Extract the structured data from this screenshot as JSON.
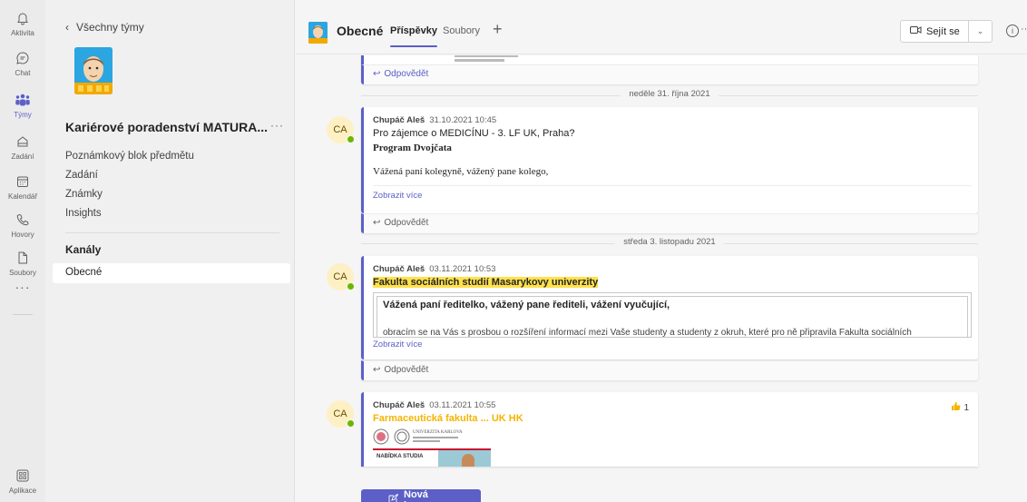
{
  "rail": {
    "items": [
      {
        "label": "Aktivita",
        "icon": "bell-icon"
      },
      {
        "label": "Chat",
        "icon": "chat-icon"
      },
      {
        "label": "Týmy",
        "icon": "teams-icon"
      },
      {
        "label": "Zadání",
        "icon": "assignments-icon"
      },
      {
        "label": "Kalendář",
        "icon": "calendar-icon"
      },
      {
        "label": "Hovory",
        "icon": "phone-icon"
      },
      {
        "label": "Soubory",
        "icon": "file-icon"
      }
    ],
    "more": "···",
    "apps_label": "Aplikace"
  },
  "teampanel": {
    "back_label": "Všechny týmy",
    "team_name": "Kariérové poradenství MATURA...",
    "more": "···",
    "nav": [
      "Poznámkový blok předmětu",
      "Zadání",
      "Známky",
      "Insights"
    ],
    "channels_heading": "Kanály",
    "channel_active": "Obecné"
  },
  "header": {
    "channel_name": "Obecné",
    "tabs": [
      "Příspěvky",
      "Soubory"
    ],
    "add_tab": "+",
    "meet_label": "Sejít se",
    "more": "··"
  },
  "feed": {
    "reply_label": "Odpovědět",
    "top_reply": "Odpovědět",
    "dates": [
      "neděle 31. října 2021",
      "středa 3. listopadu 2021"
    ],
    "messages": [
      {
        "initials": "CA",
        "author": "Chupáč Aleš",
        "time": "31.10.2021 10:45",
        "line1": "Pro zájemce o MEDICÍNU - 3. LF UK, Praha?",
        "line2": "Program Dvojčata",
        "line3": "Vážená paní kolegyně, vážený pane kolego,",
        "show_more": "Zobrazit více"
      },
      {
        "initials": "CA",
        "author": "Chupáč Aleš",
        "time": "03.11.2021 10:53",
        "title": "Fakulta sociálních studií Masarykovy univerzity",
        "box_title": "Vážená paní ředitelko, vážený pane řediteli, vážení vyučující,",
        "box_text": "obracím se na Vás s prosbou o rozšíření informací mezi Vaše studenty a studenty z okruh, které pro ně připravila Fakulta sociálních",
        "show_more": "Zobrazit více"
      },
      {
        "initials": "CA",
        "author": "Chupáč Aleš",
        "time": "03.11.2021 10:55",
        "title": "Farmaceutická fakulta ... UK HK",
        "likes": "1",
        "flyer_heading": "NABÍDKA STUDIA",
        "logo_text": "UNIVERZITA KARLOVA"
      }
    ]
  },
  "new_conversation": "Nová konverzace",
  "colors": {
    "accent": "#5b5fc7",
    "highlight": "#ffe14d",
    "orange": "#f4b400",
    "presence": "#6bb700"
  }
}
